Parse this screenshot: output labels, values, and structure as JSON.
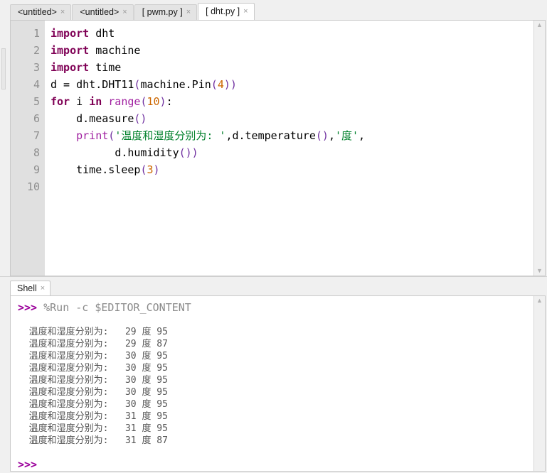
{
  "editor": {
    "tabs": [
      {
        "label": "<untitled>",
        "close": "×",
        "active": false
      },
      {
        "label": "<untitled>",
        "close": "×",
        "active": false
      },
      {
        "label": "[ pwm.py ]",
        "close": "×",
        "active": false
      },
      {
        "label": "[ dht.py ]",
        "close": "×",
        "active": true
      }
    ],
    "line_numbers": [
      "1",
      "2",
      "3",
      "4",
      "5",
      "6",
      "7",
      "8",
      "9",
      "10"
    ],
    "code": {
      "line1": {
        "kw": "import",
        "rest": " dht"
      },
      "line2": {
        "kw": "import",
        "rest": " machine"
      },
      "line3": {
        "kw": "import",
        "rest": " time"
      },
      "line4": {
        "a": "d = dht.DHT11",
        "p1": "(",
        "b": "machine.Pin",
        "p2": "(",
        "n": "4",
        "p3": "))"
      },
      "line5": {
        "kw1": "for",
        "v": " i ",
        "kw2": "in",
        "sp": " ",
        "bi": "range",
        "p1": "(",
        "n": "10",
        "p2": ")",
        "colon": ":"
      },
      "line6": {
        "indent": "    ",
        "a": "d.measure",
        "p": "()"
      },
      "line7": {
        "indent": "    ",
        "bi": "print",
        "p1": "(",
        "s1": "'温度和湿度分别为: '",
        "c1": ",d.temperature",
        "p2": "()",
        "c2": ",",
        "s2": "'度'",
        "c3": ","
      },
      "line8": {
        "indent": "          ",
        "a": "d.humidity",
        "p": "())"
      },
      "line9": {
        "indent": "    ",
        "a": "time.sleep",
        "p1": "(",
        "n": "3",
        "p2": ")"
      },
      "line10": {
        "text": ""
      }
    },
    "scroll_up_arrow": "▲",
    "scroll_down_arrow": "▼"
  },
  "shell": {
    "tab": {
      "label": "Shell",
      "close": "×"
    },
    "prompt": ">>>",
    "run_command": "%Run -c $EDITOR_CONTENT",
    "output_prefix": "温度和湿度分别为:",
    "degree_unit": "度",
    "output_lines": [
      {
        "label": "温度和湿度分别为:",
        "temperature": "29",
        "unit": "度",
        "humidity": "95"
      },
      {
        "label": "温度和湿度分别为:",
        "temperature": "29",
        "unit": "度",
        "humidity": "87"
      },
      {
        "label": "温度和湿度分别为:",
        "temperature": "30",
        "unit": "度",
        "humidity": "95"
      },
      {
        "label": "温度和湿度分别为:",
        "temperature": "30",
        "unit": "度",
        "humidity": "95"
      },
      {
        "label": "温度和湿度分别为:",
        "temperature": "30",
        "unit": "度",
        "humidity": "95"
      },
      {
        "label": "温度和湿度分别为:",
        "temperature": "30",
        "unit": "度",
        "humidity": "95"
      },
      {
        "label": "温度和湿度分别为:",
        "temperature": "30",
        "unit": "度",
        "humidity": "95"
      },
      {
        "label": "温度和湿度分别为:",
        "temperature": "31",
        "unit": "度",
        "humidity": "95"
      },
      {
        "label": "温度和湿度分别为:",
        "temperature": "31",
        "unit": "度",
        "humidity": "95"
      },
      {
        "label": "温度和湿度分别为:",
        "temperature": "31",
        "unit": "度",
        "humidity": "87"
      }
    ],
    "final_prompt": ">>>",
    "scroll_up_arrow": "▲"
  },
  "colors": {
    "keyword": "#7f0055",
    "builtin": "#a020a0",
    "string": "#00802b",
    "number": "#cc6600",
    "paren": "#7030a0",
    "prompt": "#9b009b",
    "output": "#555555",
    "gutter_bg": "#e0e0e0"
  }
}
